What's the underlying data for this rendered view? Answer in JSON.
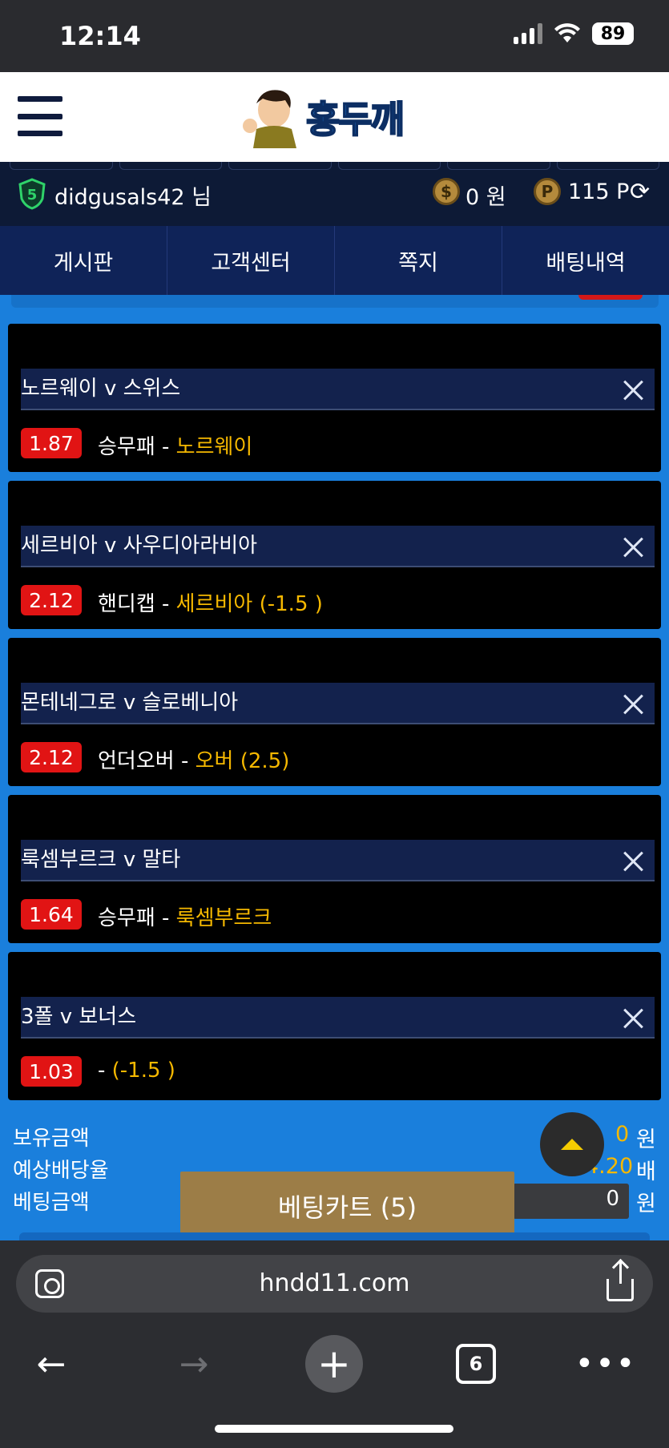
{
  "status_bar": {
    "time": "12:14",
    "battery": "89"
  },
  "header": {
    "logo_text": "홍두깨"
  },
  "user": {
    "level": "5",
    "username": "didgusals42 님",
    "money": "0 원",
    "points": "115 P"
  },
  "nav": {
    "tabs": [
      "게시판",
      "고객센터",
      "쪽지",
      "배팅내역"
    ]
  },
  "bets": [
    {
      "match": "노르웨이 v 스위스",
      "odds": "1.87",
      "market": "승무패 - ",
      "selection": "노르웨이"
    },
    {
      "match": "세르비아 v 사우디아라비아",
      "odds": "2.12",
      "market": "핸디캡 - ",
      "selection": "세르비아 (-1.5 )"
    },
    {
      "match": "몬테네그로 v 슬로베니아",
      "odds": "2.12",
      "market": "언더오버 - ",
      "selection": "오버 (2.5)"
    },
    {
      "match": "룩셈부르크 v 말타",
      "odds": "1.64",
      "market": "승무패 - ",
      "selection": "룩셈부르크"
    },
    {
      "match": "3폴 v 보너스",
      "odds": "1.03",
      "market": " - ",
      "selection": " (-1.5 )"
    }
  ],
  "summary": {
    "balance_label": "보유금액",
    "balance_value": "0",
    "balance_unit": "원",
    "expected_label": "예상배당율",
    "expected_value": "4.20",
    "expected_unit": "배",
    "stake_label": "베팅금액",
    "stake_value": "0",
    "stake_unit": "원"
  },
  "bet_cart": {
    "label": "베팅카트 (5)"
  },
  "browser": {
    "url": "hndd11.com",
    "tab_count": "6"
  },
  "colors": {
    "accent_blue": "#1a7fdc",
    "odds_red": "#e11414",
    "highlight": "#f5b800",
    "cart_gold": "#9c7d47"
  }
}
